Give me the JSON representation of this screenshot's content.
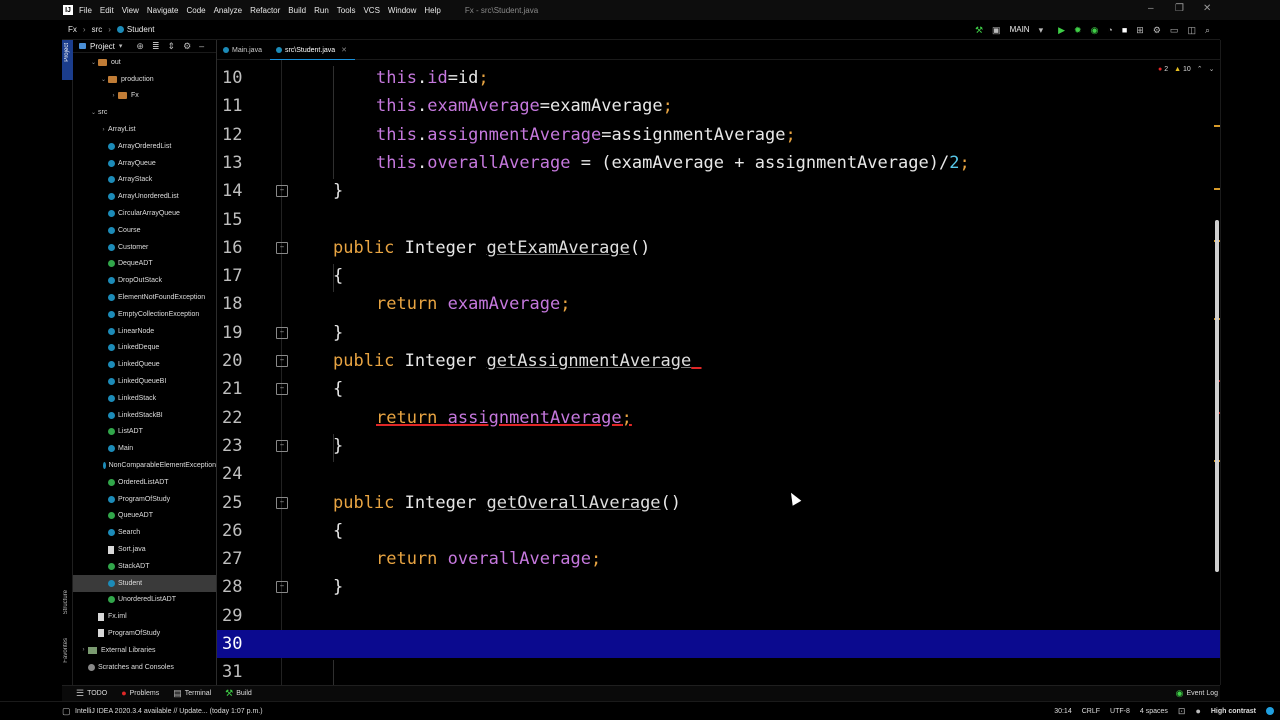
{
  "menubar": {
    "items": [
      "File",
      "Edit",
      "View",
      "Navigate",
      "Code",
      "Analyze",
      "Refactor",
      "Build",
      "Run",
      "Tools",
      "VCS",
      "Window",
      "Help"
    ],
    "title": "Fx - src\\Student.java"
  },
  "navbar": {
    "crumbs": [
      "Fx",
      "src",
      "Student"
    ],
    "run_config": "MAIN"
  },
  "project_panel": {
    "title": "Project",
    "tree": [
      {
        "label": "out",
        "depth": 1,
        "kind": "folder"
      },
      {
        "label": "production",
        "depth": 2,
        "kind": "folder"
      },
      {
        "label": "Fx",
        "depth": 3,
        "kind": "folder"
      },
      {
        "label": "src",
        "depth": 1,
        "kind": "folder-src"
      },
      {
        "label": "ArrayList",
        "depth": 2,
        "kind": "package"
      },
      {
        "label": "ArrayOrderedList",
        "depth": 2,
        "kind": "class"
      },
      {
        "label": "ArrayQueue",
        "depth": 2,
        "kind": "class"
      },
      {
        "label": "ArrayStack",
        "depth": 2,
        "kind": "class"
      },
      {
        "label": "ArrayUnorderedList",
        "depth": 2,
        "kind": "class"
      },
      {
        "label": "CircularArrayQueue",
        "depth": 2,
        "kind": "class"
      },
      {
        "label": "Course",
        "depth": 2,
        "kind": "class"
      },
      {
        "label": "Customer",
        "depth": 2,
        "kind": "class"
      },
      {
        "label": "DequeADT",
        "depth": 2,
        "kind": "interface"
      },
      {
        "label": "DropOutStack",
        "depth": 2,
        "kind": "class"
      },
      {
        "label": "ElementNotFoundException",
        "depth": 2,
        "kind": "class"
      },
      {
        "label": "EmptyCollectionException",
        "depth": 2,
        "kind": "class"
      },
      {
        "label": "LinearNode",
        "depth": 2,
        "kind": "class"
      },
      {
        "label": "LinkedDeque",
        "depth": 2,
        "kind": "class"
      },
      {
        "label": "LinkedQueue",
        "depth": 2,
        "kind": "class"
      },
      {
        "label": "LinkedQueueBI",
        "depth": 2,
        "kind": "class"
      },
      {
        "label": "LinkedStack",
        "depth": 2,
        "kind": "class"
      },
      {
        "label": "LinkedStackBI",
        "depth": 2,
        "kind": "class"
      },
      {
        "label": "ListADT",
        "depth": 2,
        "kind": "interface"
      },
      {
        "label": "Main",
        "depth": 2,
        "kind": "class"
      },
      {
        "label": "NonComparableElementException",
        "depth": 2,
        "kind": "class"
      },
      {
        "label": "OrderedListADT",
        "depth": 2,
        "kind": "interface"
      },
      {
        "label": "ProgramOfStudy",
        "depth": 2,
        "kind": "class"
      },
      {
        "label": "QueueADT",
        "depth": 2,
        "kind": "interface"
      },
      {
        "label": "Search",
        "depth": 2,
        "kind": "class"
      },
      {
        "label": "Sort.java",
        "depth": 2,
        "kind": "file"
      },
      {
        "label": "StackADT",
        "depth": 2,
        "kind": "interface"
      },
      {
        "label": "Student",
        "depth": 2,
        "kind": "class",
        "selected": true
      },
      {
        "label": "UnorderedListADT",
        "depth": 2,
        "kind": "interface"
      },
      {
        "label": "Fx.iml",
        "depth": 1,
        "kind": "file"
      },
      {
        "label": "ProgramOfStudy",
        "depth": 1,
        "kind": "file"
      },
      {
        "label": "External Libraries",
        "depth": 0,
        "kind": "library"
      },
      {
        "label": "Scratches and Consoles",
        "depth": 0,
        "kind": "scratch"
      }
    ]
  },
  "editor_tabs": [
    {
      "label": "Main.java",
      "active": false
    },
    {
      "label": "src\\Student.java",
      "active": true
    }
  ],
  "inspection": {
    "errors": "2",
    "warnings": "10"
  },
  "code_lines": [
    {
      "n": "10",
      "tokens": [
        [
          "fld",
          "this"
        ],
        [
          "p",
          "."
        ],
        [
          "fld",
          "id"
        ],
        [
          "p",
          "=id"
        ],
        [
          "kw",
          ";"
        ]
      ],
      "indent": 2
    },
    {
      "n": "11",
      "tokens": [
        [
          "fld",
          "this"
        ],
        [
          "p",
          "."
        ],
        [
          "fld",
          "examAverage"
        ],
        [
          "p",
          "=examAverage"
        ],
        [
          "kw",
          ";"
        ]
      ],
      "indent": 2
    },
    {
      "n": "12",
      "tokens": [
        [
          "fld",
          "this"
        ],
        [
          "p",
          "."
        ],
        [
          "fld",
          "assignmentAverage"
        ],
        [
          "p",
          "=assignmentAverage"
        ],
        [
          "kw",
          ";"
        ]
      ],
      "indent": 2
    },
    {
      "n": "13",
      "tokens": [
        [
          "fld",
          "this"
        ],
        [
          "p",
          "."
        ],
        [
          "fld",
          "overallAverage"
        ],
        [
          "p",
          " = (examAverage + assignmentAverage)/"
        ],
        [
          "num",
          "2"
        ],
        [
          "kw",
          ";"
        ]
      ],
      "indent": 2
    },
    {
      "n": "14",
      "tokens": [
        [
          "p",
          "}"
        ]
      ],
      "indent": 1,
      "fold": true
    },
    {
      "n": "15",
      "tokens": [],
      "indent": 0
    },
    {
      "n": "16",
      "tokens": [
        [
          "kw",
          "public "
        ],
        [
          "p",
          "Integer "
        ],
        [
          "mth",
          "getExamAverage"
        ],
        [
          "p",
          "()"
        ]
      ],
      "indent": 1,
      "fold": true
    },
    {
      "n": "17",
      "tokens": [
        [
          "p",
          "{"
        ]
      ],
      "indent": 1
    },
    {
      "n": "18",
      "tokens": [
        [
          "kw",
          "return "
        ],
        [
          "fld",
          "examAverage"
        ],
        [
          "kw",
          ";"
        ]
      ],
      "indent": 2
    },
    {
      "n": "19",
      "tokens": [
        [
          "p",
          "}"
        ]
      ],
      "indent": 1,
      "fold": true
    },
    {
      "n": "20",
      "tokens": [
        [
          "kw",
          "public "
        ],
        [
          "p",
          "Integer "
        ],
        [
          "mth",
          "getAssignmentAverage"
        ],
        [
          "err",
          " "
        ]
      ],
      "indent": 1,
      "fold": true
    },
    {
      "n": "21",
      "tokens": [
        [
          "p",
          "{"
        ]
      ],
      "indent": 1,
      "fold": true
    },
    {
      "n": "22",
      "tokens": [
        [
          "kwerr",
          "return "
        ],
        [
          "flderr",
          "assignmentAverage"
        ],
        [
          "kwerr",
          ";"
        ]
      ],
      "indent": 2
    },
    {
      "n": "23",
      "tokens": [
        [
          "p",
          "}"
        ]
      ],
      "indent": 1,
      "fold": true
    },
    {
      "n": "24",
      "tokens": [],
      "indent": 0
    },
    {
      "n": "25",
      "tokens": [
        [
          "kw",
          "public "
        ],
        [
          "p",
          "Integer "
        ],
        [
          "mth",
          "getOverallAverage"
        ],
        [
          "p",
          "()"
        ]
      ],
      "indent": 1,
      "fold": true
    },
    {
      "n": "26",
      "tokens": [
        [
          "p",
          "{"
        ]
      ],
      "indent": 1
    },
    {
      "n": "27",
      "tokens": [
        [
          "kw",
          "return "
        ],
        [
          "fld",
          "overallAverage"
        ],
        [
          "kw",
          ";"
        ]
      ],
      "indent": 2
    },
    {
      "n": "28",
      "tokens": [
        [
          "p",
          "}"
        ]
      ],
      "indent": 1,
      "fold": true
    },
    {
      "n": "29",
      "tokens": [],
      "indent": 0
    },
    {
      "n": "30",
      "tokens": [],
      "indent": 0,
      "current": true
    },
    {
      "n": "31",
      "tokens": [],
      "indent": 0
    }
  ],
  "bottom_tools": [
    "TODO",
    "Problems",
    "Terminal",
    "Build"
  ],
  "event_log": "Event Log",
  "status": {
    "message": "IntelliJ IDEA 2020.3.4 available // Update... (today 1:07 p.m.)",
    "position": "30:14",
    "line_sep": "CRLF",
    "encoding": "UTF-8",
    "indent": "4 spaces",
    "theme": "High contrast"
  },
  "side_tabs": {
    "structure": "Structure",
    "favorites": "Favorites"
  }
}
